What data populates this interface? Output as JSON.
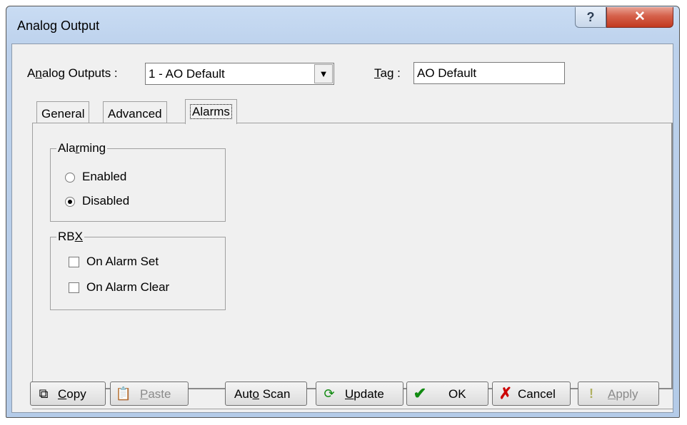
{
  "window": {
    "title": "Analog Output"
  },
  "caption": {
    "help_glyph": "?",
    "close_glyph": "✕"
  },
  "header": {
    "outputs_label_pre": "A",
    "outputs_label_ul": "n",
    "outputs_label_post": "alog Outputs :",
    "outputs_value": "1 - AO Default",
    "tag_label_ul": "T",
    "tag_label_post": "ag :",
    "tag_value": "AO Default"
  },
  "tabs": [
    {
      "label": "General"
    },
    {
      "label": "Advanced"
    },
    {
      "label": "Alarms",
      "active": true
    }
  ],
  "alarming": {
    "title_pre": "Ala",
    "title_ul": "r",
    "title_post": "ming",
    "options": [
      {
        "label": "Enabled",
        "selected": false
      },
      {
        "label": "Disabled",
        "selected": true
      }
    ]
  },
  "rbx": {
    "title_pre": "RB",
    "title_ul": "X",
    "options": [
      {
        "label": "On Alarm Set",
        "checked": false
      },
      {
        "label": "On Alarm Clear",
        "checked": false
      }
    ]
  },
  "buttons": {
    "copy": {
      "ul": "C",
      "rest": "opy",
      "icon": "copy-icon"
    },
    "paste": {
      "ul": "P",
      "rest": "aste",
      "icon": "paste-icon",
      "disabled": true
    },
    "autoscan": {
      "pre": "Aut",
      "ul": "o",
      "rest": " Scan"
    },
    "update": {
      "ul": "U",
      "rest": "pdate",
      "icon": "refresh-icon"
    },
    "ok": {
      "label": "OK",
      "icon": "checkmark-icon"
    },
    "cancel": {
      "label": "Cancel",
      "icon": "x-icon"
    },
    "apply": {
      "ul": "A",
      "rest": "pply",
      "icon": "exclamation-icon",
      "disabled": true
    }
  },
  "colors": {
    "ok_icon": "#108a10",
    "cancel_icon": "#cc0000",
    "close_button": "#c8432b"
  }
}
